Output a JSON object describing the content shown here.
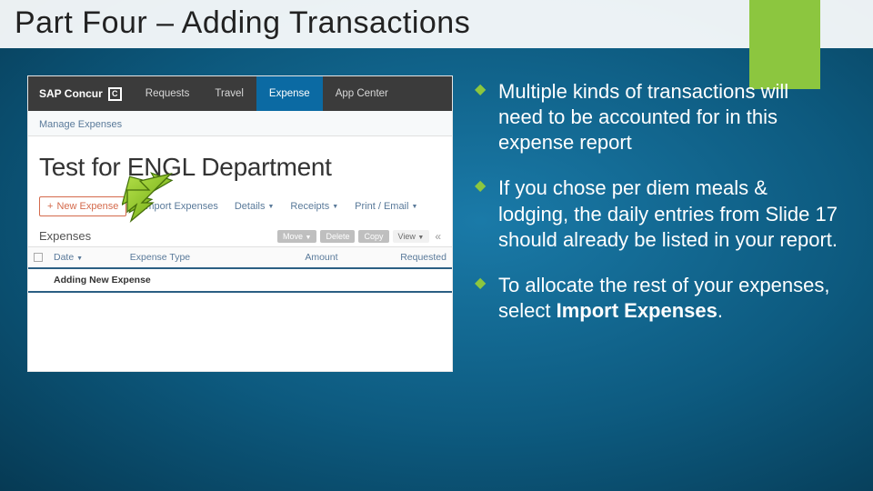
{
  "slide": {
    "title": "Part Four – Adding Transactions"
  },
  "bullets": [
    "Multiple kinds of transactions will need to be accounted for in this expense report",
    "If you chose per diem meals & lodging, the daily entries from Slide 17 should already be listed in your report.",
    "To allocate the rest of your expenses, select <strong>Import Expenses</strong>."
  ],
  "app": {
    "brandText": "SAP Concur",
    "nav": [
      "Requests",
      "Travel",
      "Expense",
      "App Center"
    ],
    "activeNavIndex": 2,
    "subhead": "Manage Expenses",
    "reportTitle": "Test for ENGL Department",
    "toolbar": {
      "newExpense": "New Expense",
      "importExpenses": "Import Expenses",
      "details": "Details",
      "receipts": "Receipts",
      "printEmail": "Print / Email"
    },
    "sectionLabel": "Expenses",
    "miniActions": {
      "move": "Move",
      "delete": "Delete",
      "copy": "Copy",
      "view": "View"
    },
    "columns": {
      "date": "Date",
      "expenseType": "Expense Type",
      "amount": "Amount",
      "requested": "Requested"
    },
    "addingRow": "Adding New Expense"
  }
}
